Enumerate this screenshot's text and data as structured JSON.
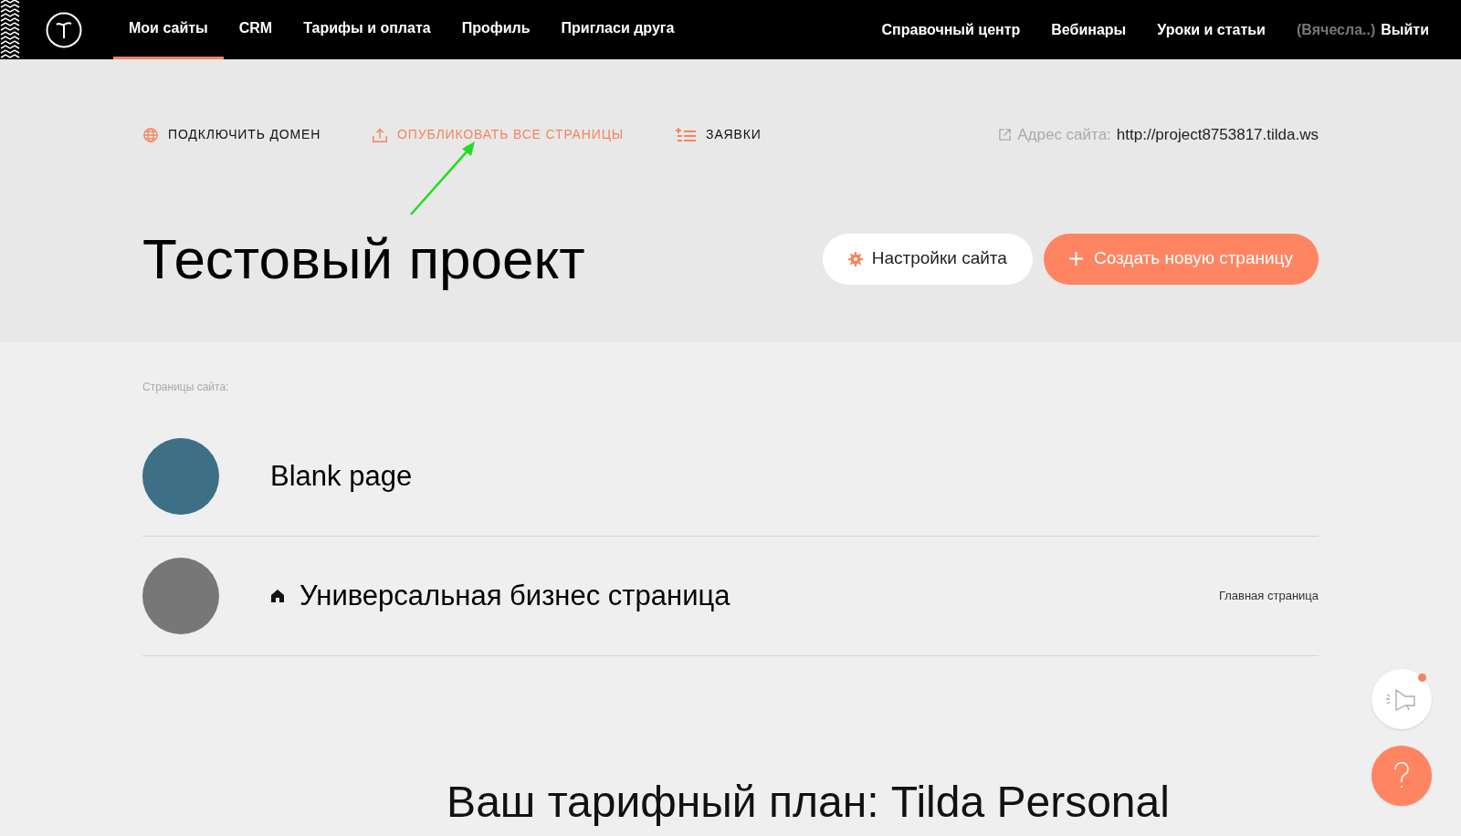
{
  "nav": {
    "items": [
      {
        "label": "Мои сайты",
        "selected": true
      },
      {
        "label": "CRM",
        "selected": false
      },
      {
        "label": "Тарифы и оплата",
        "selected": false
      },
      {
        "label": "Профиль",
        "selected": false
      },
      {
        "label": "Пригласи друга",
        "selected": false
      }
    ],
    "right_links": [
      "Справочный центр",
      "Вебинары",
      "Уроки и статьи"
    ],
    "user": "(Вячесла..)",
    "logout": "Выйти"
  },
  "actions": [
    {
      "kind": "domain",
      "label": "ПОДКЛЮЧИТЬ ДОМЕН",
      "highlighted": false
    },
    {
      "kind": "publish",
      "label": "ОПУБЛИКОВАТЬ ВСЕ СТРАНИЦЫ",
      "highlighted": true
    },
    {
      "kind": "leads",
      "label": "ЗАЯВКИ",
      "highlighted": false
    }
  ],
  "site_address": {
    "label": "Адрес сайта:",
    "url": "http://project8753817.tilda.ws"
  },
  "project_title": "Тестовый проект",
  "settings_button": "Настройки сайта",
  "create_button": "Создать новую страницу",
  "pages_label": "Страницы сайта:",
  "pages": [
    {
      "title": "Blank page",
      "home": false
    },
    {
      "title": "Универсальная бизнес страница",
      "home": true,
      "badge": "Главная страница"
    }
  ],
  "plan_heading": "Ваш тарифный план: Tilda Personal",
  "notifications": {
    "unread": true
  }
}
